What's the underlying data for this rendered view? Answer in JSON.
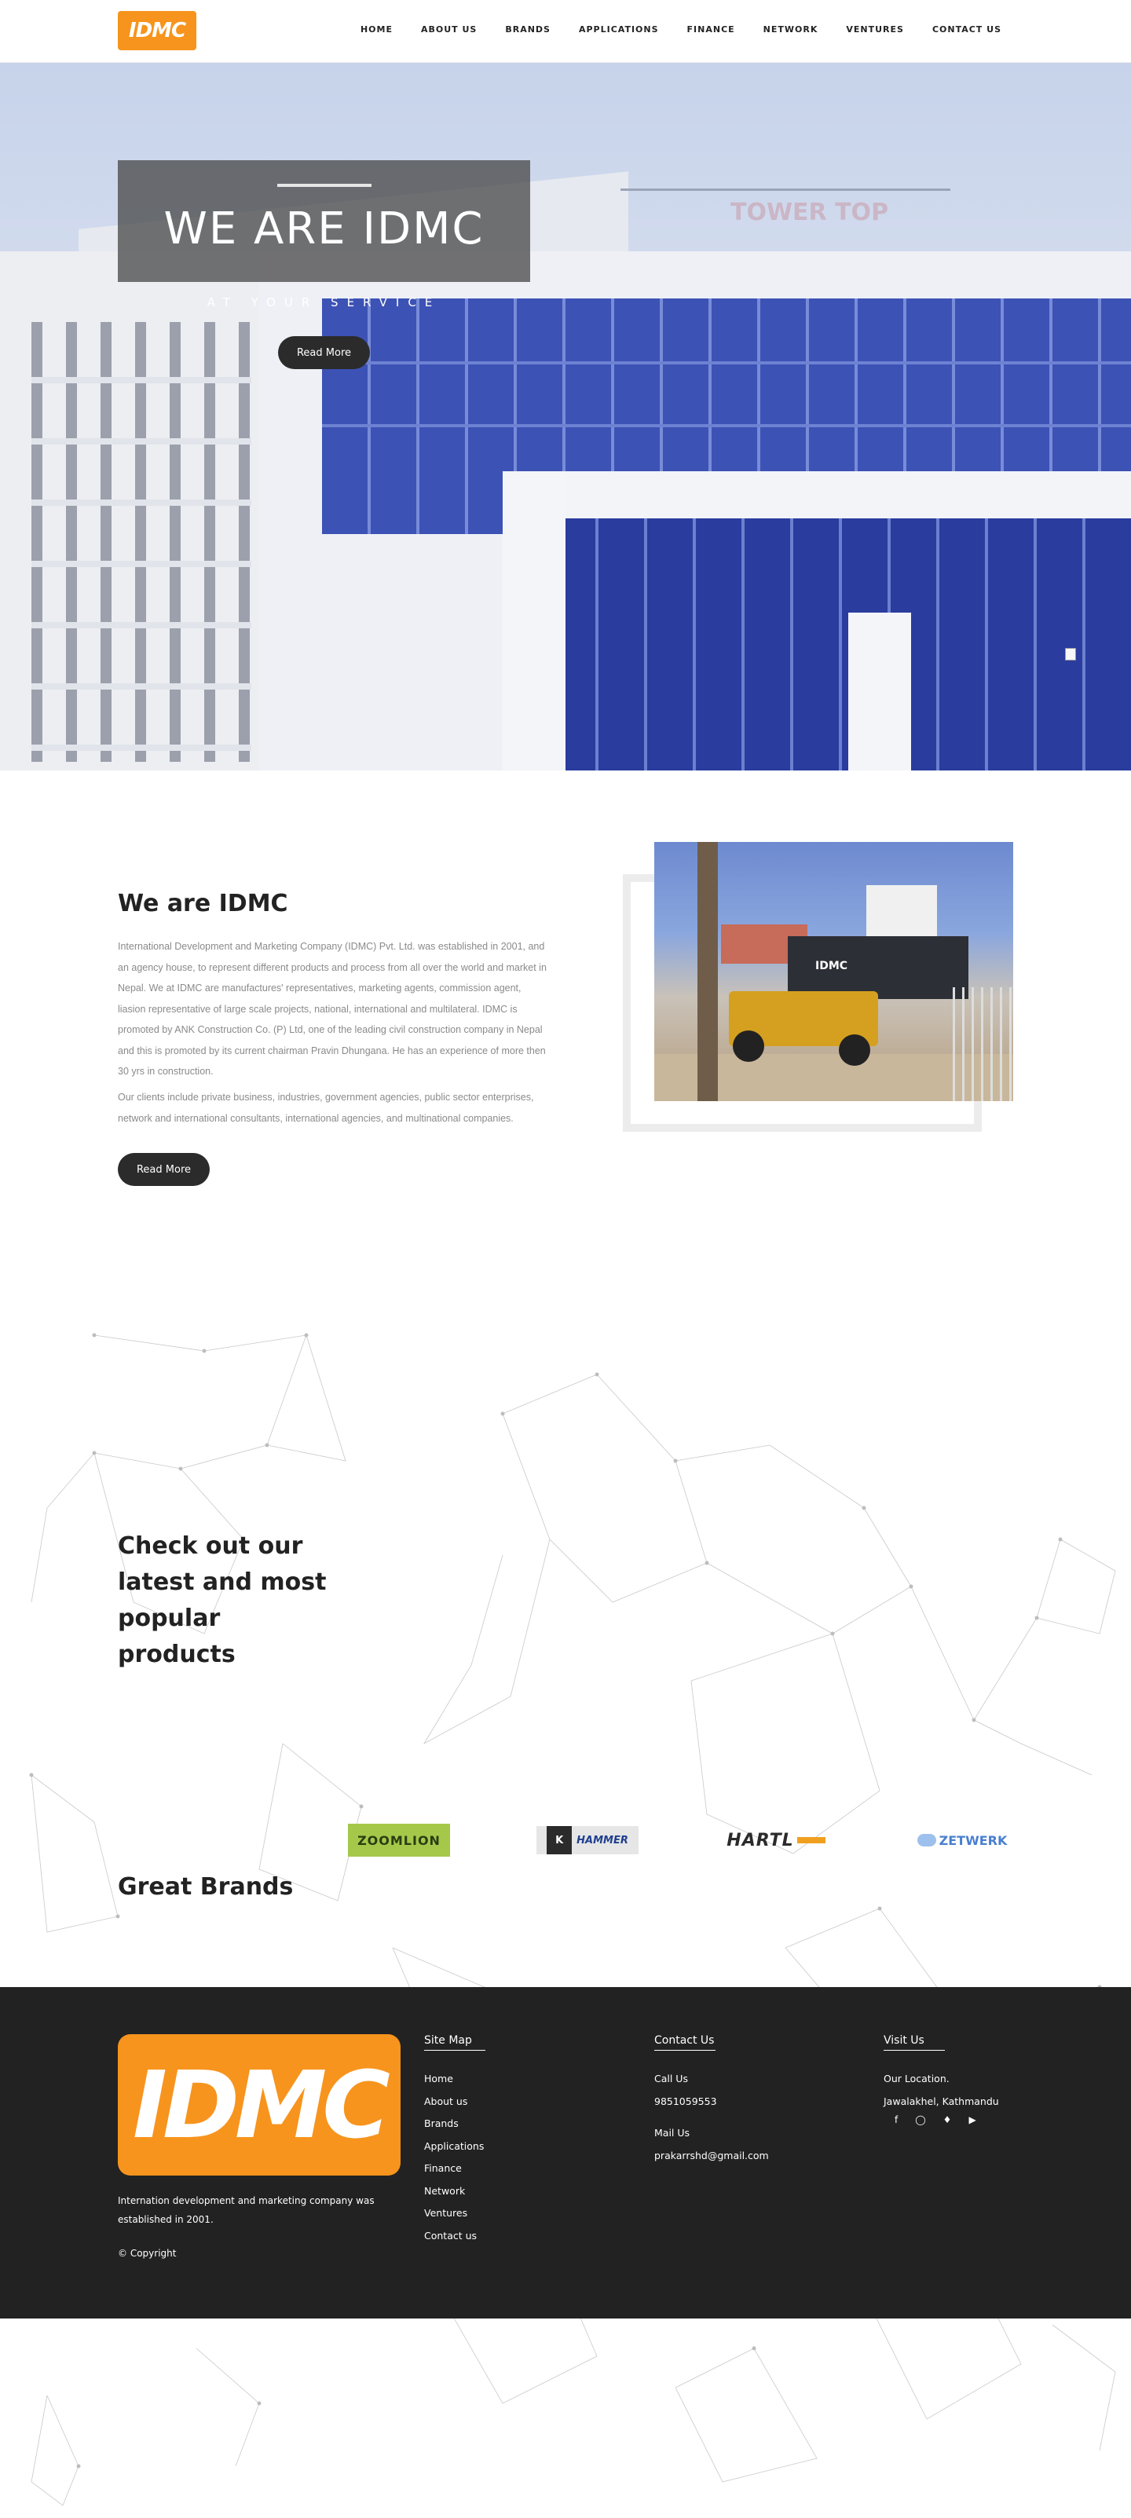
{
  "header": {
    "logo_text": "IDMC",
    "nav": [
      "HOME",
      "ABOUT US",
      "BRANDS",
      "APPLICATIONS",
      "FINANCE",
      "NETWORK",
      "VENTURES",
      "CONTACT US"
    ]
  },
  "hero": {
    "title": "WE ARE IDMC",
    "subtitle": "AT YOUR SERVICE",
    "button": "Read More",
    "rooftop_sign": "TOWER TOP"
  },
  "about": {
    "title": "We are IDMC",
    "paragraph1": "International Development and Marketing Company (IDMC) Pvt. Ltd. was established in 2001, and an agency house, to represent different products and process from all over the world and market in Nepal. We at IDMC are manufactures' representatives, marketing agents, commission agent, liasion representative of large scale projects, national, international and multilateral. IDMC is promoted by ANK Construction Co. (P) Ltd, one of the leading civil construction company in Nepal and this is promoted by its current chairman Pravin Dhungana. He has an experience of more then 30 yrs in construction.",
    "paragraph2": "Our clients include private business, industries, government agencies, public sector enterprises, network and international consultants, international agencies, and multinational companies.",
    "button": "Read More",
    "photo_sign": "IDMC"
  },
  "products": {
    "title": "Check out our latest and most popular products"
  },
  "brands": {
    "title": "Great Brands",
    "items": [
      "ZOOMLION",
      "HAMMER",
      "HARTL",
      "ZETWERK"
    ],
    "hammer_badge": "K"
  },
  "footer": {
    "logo_text": "IDMC",
    "description": "Internation development and marketing company was established in 2001.",
    "copyright": "© Copyright",
    "sitemap": {
      "title": "Site Map",
      "links": [
        "Home",
        "About us",
        "Brands",
        "Applications",
        "Finance",
        "Network",
        "Ventures",
        "Contact us"
      ]
    },
    "contact": {
      "title": "Contact Us",
      "call_label": "Call Us",
      "phone": "9851059553",
      "mail_label": "Mail Us",
      "email": "prakarrshd@gmail.com"
    },
    "visit": {
      "title": "Visit Us",
      "location_label": "Our Location.",
      "location": "Jawalakhel, Kathmandu",
      "social_icons": [
        "facebook-icon",
        "instagram-icon",
        "twitter-icon",
        "youtube-icon"
      ]
    }
  },
  "colors": {
    "brand_orange": "#f7941d",
    "dark": "#222222",
    "button_dark": "#2b2b2b"
  }
}
